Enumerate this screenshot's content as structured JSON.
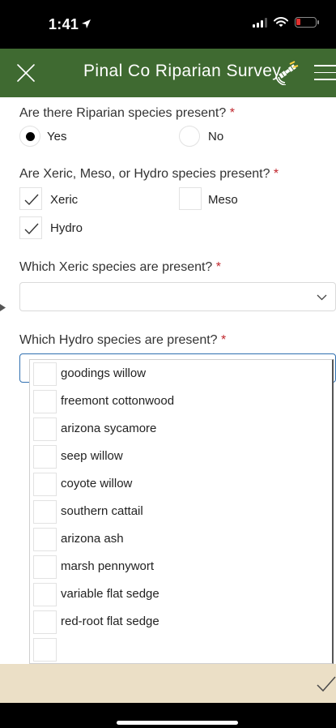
{
  "status_bar": {
    "time": "1:41",
    "icons": [
      "location-arrow-icon",
      "signal-bars-icon",
      "wifi-icon",
      "battery-low-icon"
    ]
  },
  "app_bar": {
    "title": "Pinal Co Riparian Survey",
    "close_icon": "close-icon",
    "satellite_icon": "satellite-icon",
    "menu_icon": "hamburger-menu-icon"
  },
  "questions": {
    "riparian": {
      "label": "Are there Riparian species present?",
      "required_mark": "*",
      "options": [
        {
          "label": "Yes",
          "selected": true
        },
        {
          "label": "No",
          "selected": false
        }
      ]
    },
    "types": {
      "label": "Are Xeric, Meso, or Hydro species present?",
      "required_mark": "*",
      "options": [
        {
          "label": "Xeric",
          "checked": true
        },
        {
          "label": "Meso",
          "checked": false
        },
        {
          "label": "Hydro",
          "checked": true
        }
      ]
    },
    "xeric": {
      "label": "Which Xeric species are present?",
      "required_mark": "*",
      "value": "",
      "expanded": false
    },
    "hydro": {
      "label": "Which Hydro species are present?",
      "required_mark": "*",
      "value": "",
      "expanded": true,
      "options": [
        {
          "label": "goodings willow",
          "checked": false
        },
        {
          "label": "freemont cottonwood",
          "checked": false
        },
        {
          "label": "arizona sycamore",
          "checked": false
        },
        {
          "label": "seep willow",
          "checked": false
        },
        {
          "label": "coyote willow",
          "checked": false
        },
        {
          "label": "southern cattail",
          "checked": false
        },
        {
          "label": "arizona ash",
          "checked": false
        },
        {
          "label": "marsh pennywort",
          "checked": false
        },
        {
          "label": "variable flat sedge",
          "checked": false
        },
        {
          "label": "red-root flat sedge",
          "checked": false
        }
      ]
    }
  },
  "footer": {
    "submit_icon": "checkmark-icon"
  },
  "colors": {
    "app_bar": "#3f6a31",
    "required": "#c0262d",
    "footer": "#ebdfc6",
    "focus_border": "#2f6fb0",
    "battery_low": "#e0302e"
  }
}
